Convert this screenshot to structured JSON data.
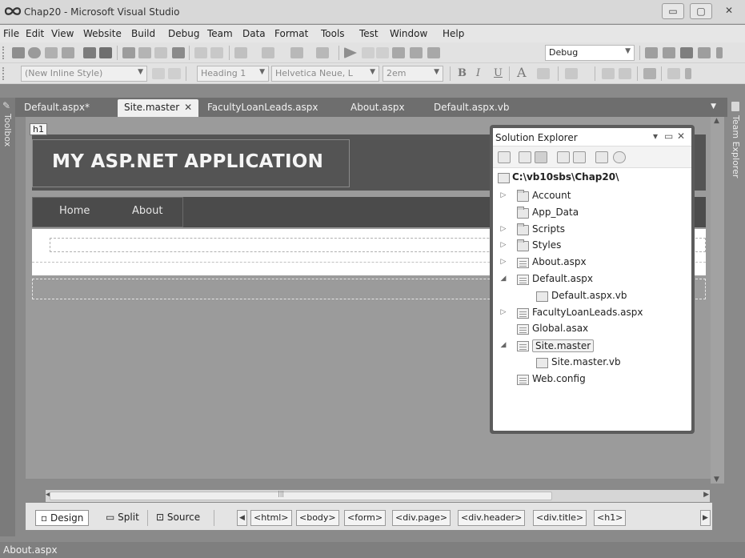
{
  "window": {
    "title": "Chap20 - Microsoft Visual Studio",
    "controls": [
      "▭",
      "▢",
      "✕"
    ]
  },
  "menu": [
    "File",
    "Edit",
    "View",
    "Website",
    "Build",
    "Debug",
    "Team",
    "Data",
    "Format",
    "Tools",
    "Test",
    "Window",
    "Help"
  ],
  "toolbar": {
    "config": "Debug",
    "style": "(New Inline Style)",
    "block_format": "Heading 1",
    "font": "Helvetica Neue, L",
    "size": "2em",
    "bold": "B",
    "italic": "I",
    "underline": "U",
    "font_color": "A"
  },
  "tabs": [
    {
      "label": "Default.aspx*"
    },
    {
      "label": "Site.master",
      "active": true
    },
    {
      "label": "FacultyLoanLeads.aspx"
    },
    {
      "label": "About.aspx"
    },
    {
      "label": "Default.aspx.vb"
    }
  ],
  "tab_close": "✕",
  "toolbox_label": "Toolbox",
  "team_explorer_label": "Team Explorer",
  "designer": {
    "tag_label": "h1",
    "app_title": "MY ASP.NET APPLICATION",
    "nav": [
      "Home",
      "About"
    ]
  },
  "view_bar": {
    "modes": [
      {
        "label": "Design",
        "icon": "▫",
        "active": true
      },
      {
        "label": "Split",
        "icon": "▭"
      },
      {
        "label": "Source",
        "icon": "⊡"
      }
    ],
    "breadcrumbs": [
      "<html>",
      "<body>",
      "<form>",
      "<div.page>",
      "<div.header>",
      "<div.title>",
      "<h1>"
    ]
  },
  "solution_explorer": {
    "title": "Solution Explorer",
    "controls": [
      "▾",
      "▭",
      "✕"
    ],
    "root": "C:\\vb10sbs\\Chap20\\",
    "items": [
      {
        "label": "Account",
        "icon": "folder",
        "expander": "▷"
      },
      {
        "label": "App_Data",
        "icon": "folder",
        "expander": ""
      },
      {
        "label": "Scripts",
        "icon": "folder",
        "expander": "▷"
      },
      {
        "label": "Styles",
        "icon": "folder",
        "expander": "▷"
      },
      {
        "label": "About.aspx",
        "icon": "page",
        "expander": "▷"
      },
      {
        "label": "Default.aspx",
        "icon": "page",
        "expander": "◢"
      },
      {
        "label": "Default.aspx.vb",
        "icon": "vbfile",
        "expander": "",
        "child": true
      },
      {
        "label": "FacultyLoanLeads.aspx",
        "icon": "page",
        "expander": "▷"
      },
      {
        "label": "Global.asax",
        "icon": "page",
        "expander": ""
      },
      {
        "label": "Site.master",
        "icon": "master",
        "expander": "◢",
        "selected": true
      },
      {
        "label": "Site.master.vb",
        "icon": "vbfile",
        "expander": "",
        "child": true
      },
      {
        "label": "Web.config",
        "icon": "page",
        "expander": ""
      }
    ]
  },
  "status": "About.aspx"
}
